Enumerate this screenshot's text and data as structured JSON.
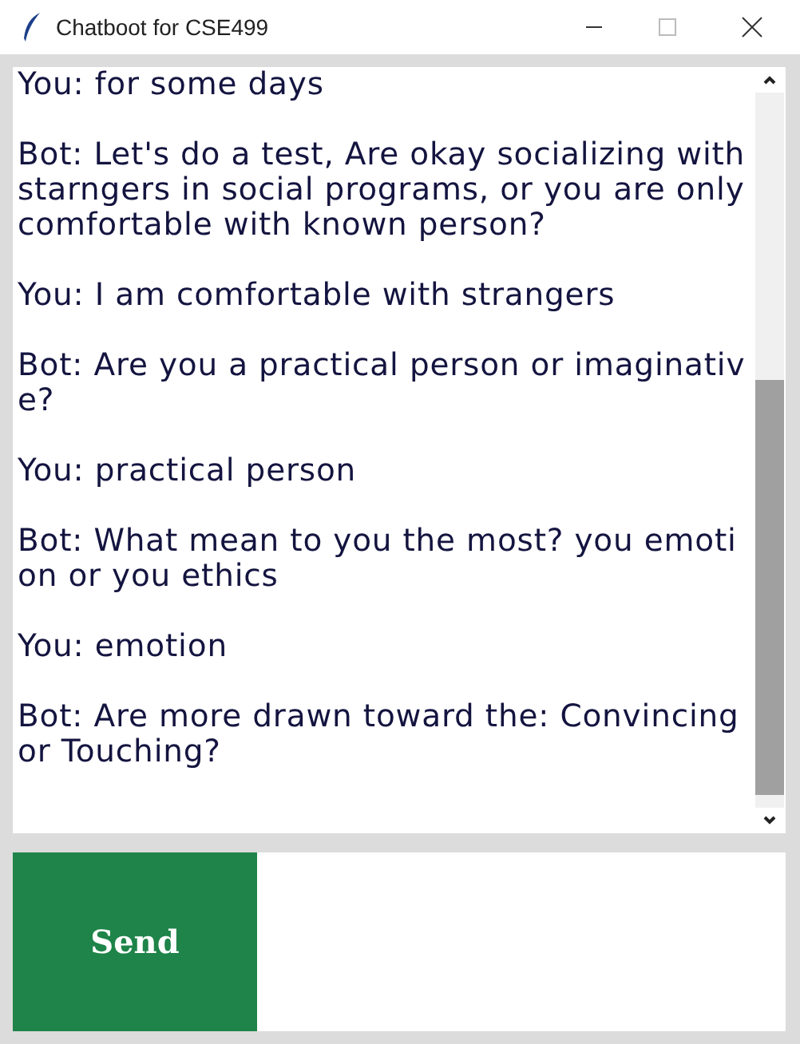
{
  "window": {
    "title": "Chatboot for CSE499"
  },
  "messages": [
    {
      "text": "You: for some days"
    },
    {
      "text": "Bot: Let's do a test, Are okay socializing with starngers in social programs, or you are only comfortable with known person?"
    },
    {
      "text": "You: I am comfortable with strangers"
    },
    {
      "text": "Bot: Are you a practical person or imaginative?"
    },
    {
      "text": "You: practical person"
    },
    {
      "text": "Bot: What mean to you the most? you emotion or you ethics"
    },
    {
      "text": "You: emotion"
    },
    {
      "text": "Bot: Are more drawn toward the: Convincing or Touching?"
    }
  ],
  "send_button": {
    "label": "Send"
  }
}
